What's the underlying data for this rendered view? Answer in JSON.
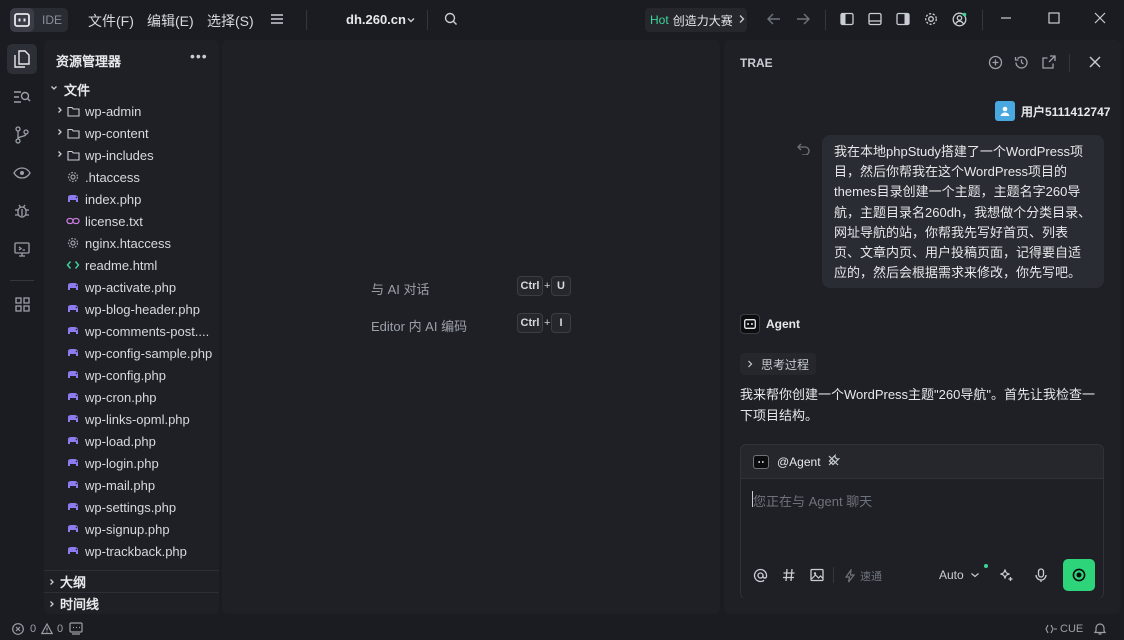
{
  "titlebar": {
    "ide_label": "IDE",
    "menus": [
      "文件(F)",
      "编辑(E)",
      "选择(S)"
    ],
    "project": "dh.260.cn",
    "hot_tag": "Hot",
    "hot_text": "创造力大赛"
  },
  "explorer": {
    "title": "资源管理器",
    "root": "文件",
    "items": [
      {
        "label": "wp-admin",
        "kind": "folder"
      },
      {
        "label": "wp-content",
        "kind": "folder"
      },
      {
        "label": "wp-includes",
        "kind": "folder"
      },
      {
        "label": ".htaccess",
        "kind": "gear"
      },
      {
        "label": "index.php",
        "kind": "php"
      },
      {
        "label": "license.txt",
        "kind": "txt"
      },
      {
        "label": "nginx.htaccess",
        "kind": "gear"
      },
      {
        "label": "readme.html",
        "kind": "html"
      },
      {
        "label": "wp-activate.php",
        "kind": "php"
      },
      {
        "label": "wp-blog-header.php",
        "kind": "php"
      },
      {
        "label": "wp-comments-post....",
        "kind": "php"
      },
      {
        "label": "wp-config-sample.php",
        "kind": "php"
      },
      {
        "label": "wp-config.php",
        "kind": "php"
      },
      {
        "label": "wp-cron.php",
        "kind": "php"
      },
      {
        "label": "wp-links-opml.php",
        "kind": "php"
      },
      {
        "label": "wp-load.php",
        "kind": "php"
      },
      {
        "label": "wp-login.php",
        "kind": "php"
      },
      {
        "label": "wp-mail.php",
        "kind": "php"
      },
      {
        "label": "wp-settings.php",
        "kind": "php"
      },
      {
        "label": "wp-signup.php",
        "kind": "php"
      },
      {
        "label": "wp-trackback.php",
        "kind": "php"
      }
    ],
    "sections": [
      "大纲",
      "时间线"
    ]
  },
  "editor": {
    "hint1": "与 AI 对话",
    "hint1_keys": [
      "Ctrl",
      "U"
    ],
    "hint2": "Editor 内 AI 编码",
    "hint2_keys": [
      "Ctrl",
      "I"
    ]
  },
  "chat": {
    "title": "TRAE",
    "user_name": "用户5111412747",
    "user_message_lines": [
      "我在本地phpStudy搭建了一个WordPress项",
      "目，然后你帮我在这个WordPress项目的",
      "themes目录创建一个主题，主题名字260导",
      "航，主题目录名260dh，我想做个分类目录、",
      "网址导航的站，你帮我先写好首页、列表",
      "页、文章内页、用户投稿页面，记得要自适",
      "应的，然后会根据需求来修改，你先写吧。"
    ],
    "agent_name": "Agent",
    "thinking_label": "思考过程",
    "agent_reply": "我来帮你创建一个WordPress主题\"260导航\"。首先让我检查一下项目结构。",
    "input_mention": "@Agent",
    "input_placeholder": "您正在与 Agent 聊天",
    "speed_label": "速通",
    "mode_label": "Auto"
  },
  "status": {
    "errors": "0",
    "warnings": "0",
    "right_label": "CUE"
  },
  "colors": {
    "accent_green": "#2ed47a",
    "hot_green": "#3ed598",
    "php_purple": "#8c7cf0"
  }
}
